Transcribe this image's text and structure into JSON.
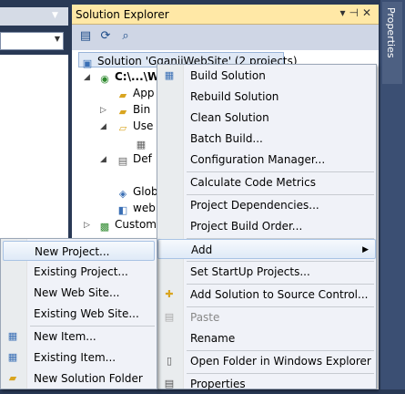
{
  "solution_explorer": {
    "title": "Solution Explorer",
    "header_controls": [
      "▾",
      "⊣",
      "✕"
    ],
    "solution_label": "Solution 'GganiiWebSite' (2 projects)",
    "tree": [
      {
        "label": "C:\\...\\W",
        "icon": "web-project-icon"
      },
      {
        "label": "App",
        "icon": "folder-icon"
      },
      {
        "label": "Bin",
        "icon": "folder-icon"
      },
      {
        "label": "Use",
        "icon": "folder-icon"
      },
      {
        "label": "",
        "icon": "web-page-icon"
      },
      {
        "label": "Def",
        "icon": "page-icon"
      },
      {
        "label": "Glob",
        "icon": "global-asax-icon"
      },
      {
        "label": "web",
        "icon": "config-icon"
      },
      {
        "label": "Custom",
        "icon": "custom-project-icon"
      }
    ]
  },
  "properties_tab": {
    "label": "Properties"
  },
  "context_menu": {
    "items": [
      {
        "label": "Build Solution",
        "icon": "build-icon"
      },
      {
        "label": "Rebuild Solution",
        "icon": ""
      },
      {
        "label": "Clean Solution",
        "icon": ""
      },
      {
        "label": "Batch Build...",
        "icon": ""
      },
      {
        "label": "Configuration Manager...",
        "icon": ""
      },
      {
        "label": "Calculate Code Metrics",
        "icon": ""
      },
      {
        "label": "Project Dependencies...",
        "icon": ""
      },
      {
        "label": "Project Build Order...",
        "icon": ""
      },
      {
        "label": "Add",
        "icon": ""
      },
      {
        "label": "Set StartUp Projects...",
        "icon": ""
      },
      {
        "label": "Add Solution to Source Control...",
        "icon": "source-control-icon"
      },
      {
        "label": "Paste",
        "icon": "paste-icon",
        "disabled": true
      },
      {
        "label": "Rename",
        "icon": ""
      },
      {
        "label": "Open Folder in Windows Explorer",
        "icon": ""
      },
      {
        "label": "Properties",
        "icon": "properties-icon"
      }
    ]
  },
  "add_submenu": {
    "items": [
      {
        "label": "New Project..."
      },
      {
        "label": "Existing Project..."
      },
      {
        "label": "New Web Site..."
      },
      {
        "label": "Existing Web Site..."
      },
      {
        "label": "New Item..."
      },
      {
        "label": "Existing Item..."
      },
      {
        "label": "New Solution Folder"
      }
    ]
  }
}
